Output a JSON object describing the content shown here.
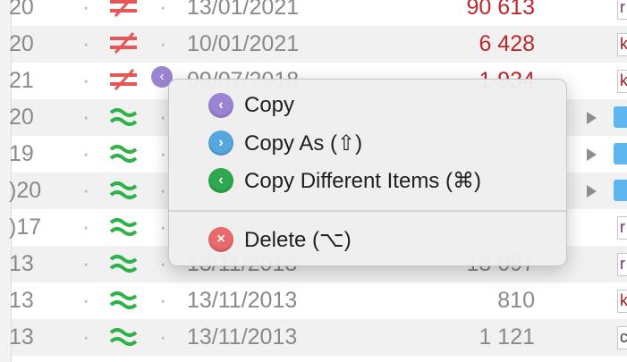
{
  "rows": [
    {
      "year": "20",
      "dot1": "·",
      "symbol": "not-equal",
      "dot2": "·",
      "date": "13/01/2021",
      "amount": "90 613",
      "amount_red": true,
      "tag": "r",
      "tag_color": "#7a2a7a"
    },
    {
      "year": "20",
      "dot1": "·",
      "symbol": "not-equal",
      "dot2": "·",
      "date": "10/01/2021",
      "amount": "6 428",
      "amount_red": true,
      "tag": "k",
      "tag_color": "#a01a1a"
    },
    {
      "year": "21",
      "dot1": "·",
      "symbol": "not-equal",
      "dot2": "",
      "date": "09/07/2018",
      "amount": "1 934",
      "amount_red": true,
      "tag": "k",
      "tag_color": "#a01a1a"
    },
    {
      "year": "20",
      "dot1": "·",
      "symbol": "approx",
      "dot2": "·",
      "date": "",
      "amount": "",
      "amount_red": false,
      "tag": "",
      "tag_color": ""
    },
    {
      "year": "19",
      "dot1": "·",
      "symbol": "approx",
      "dot2": "·",
      "date": "",
      "amount": "",
      "amount_red": false,
      "tag": "",
      "tag_color": ""
    },
    {
      "year": ")20",
      "dot1": "·",
      "symbol": "approx",
      "dot2": "·",
      "date": "",
      "amount": "",
      "amount_red": false,
      "tag": "",
      "tag_color": ""
    },
    {
      "year": ")17",
      "dot1": "·",
      "symbol": "approx",
      "dot2": "·",
      "date": "",
      "amount": "",
      "amount_red": false,
      "tag": "r",
      "tag_color": "#6a2a6a"
    },
    {
      "year": "13",
      "dot1": "·",
      "symbol": "approx",
      "dot2": "·",
      "date": "13/11/2013",
      "amount": "13 097",
      "amount_red": false,
      "tag": "r",
      "tag_color": "#6a2a6a"
    },
    {
      "year": "13",
      "dot1": "·",
      "symbol": "approx",
      "dot2": "·",
      "date": "13/11/2013",
      "amount": "810",
      "amount_red": false,
      "tag": "k",
      "tag_color": "#a01a1a"
    },
    {
      "year": "13",
      "dot1": "·",
      "symbol": "approx",
      "dot2": "·",
      "date": "13/11/2013",
      "amount": "1 121",
      "amount_red": false,
      "tag": "c",
      "tag_color": "#3a3a3a"
    }
  ],
  "folder_rows": [
    3,
    4,
    5
  ],
  "context_menu": {
    "items": [
      {
        "label": "Copy",
        "icon": "copy-left-icon",
        "glyph": "‹",
        "color": "#9c84d4"
      },
      {
        "label": "Copy As (⇧)",
        "icon": "copy-right-icon",
        "glyph": "›",
        "color": "#56a7e0"
      },
      {
        "label": "Copy Different Items (⌘)",
        "icon": "copy-different-icon",
        "glyph": "‹",
        "color": "#2fa84f"
      },
      {
        "label": "Delete (⌥)",
        "icon": "delete-icon",
        "glyph": "×",
        "color": "#e96a6a"
      }
    ]
  },
  "colors": {
    "not_equal": "#e65656",
    "approx": "#2fb24a",
    "amount_red": "#c0262b"
  }
}
